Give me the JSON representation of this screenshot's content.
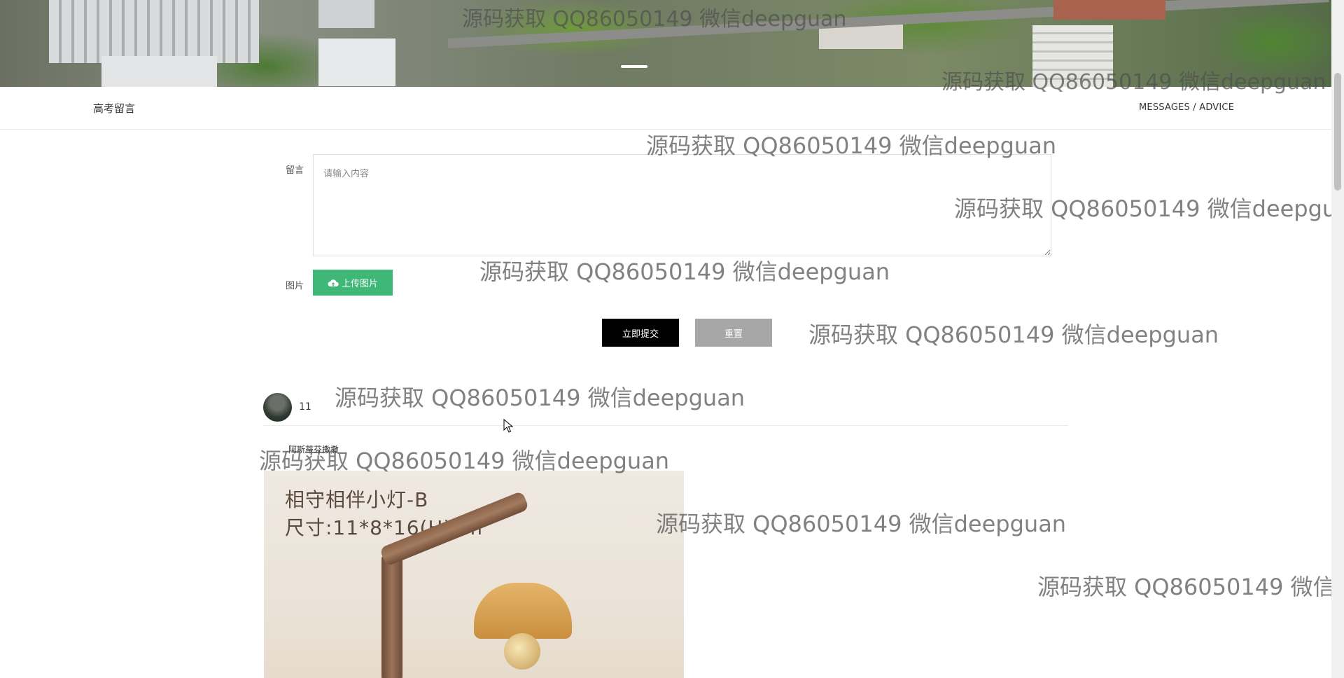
{
  "nav": {
    "title": "高考留言",
    "subtitle": "MESSAGES / ADVICE"
  },
  "form": {
    "message_label": "留言",
    "message_placeholder": "请输入内容",
    "image_label": "图片",
    "upload_label": "上传图片",
    "submit_label": "立即提交",
    "reset_label": "重置"
  },
  "comments": [
    {
      "username": "11",
      "text": "阿斯蒂芬撒撒",
      "image_text": [
        "相守相伴小灯-B",
        "尺寸:11*8*16(H)cm"
      ]
    }
  ],
  "watermark": "源码获取 QQ86050149 微信deepguan",
  "colors": {
    "upload_button": "#3fb877",
    "submit_button": "#000000",
    "reset_button": "#a7a7a7"
  },
  "icons": {
    "upload": "cloud-upload-icon"
  }
}
